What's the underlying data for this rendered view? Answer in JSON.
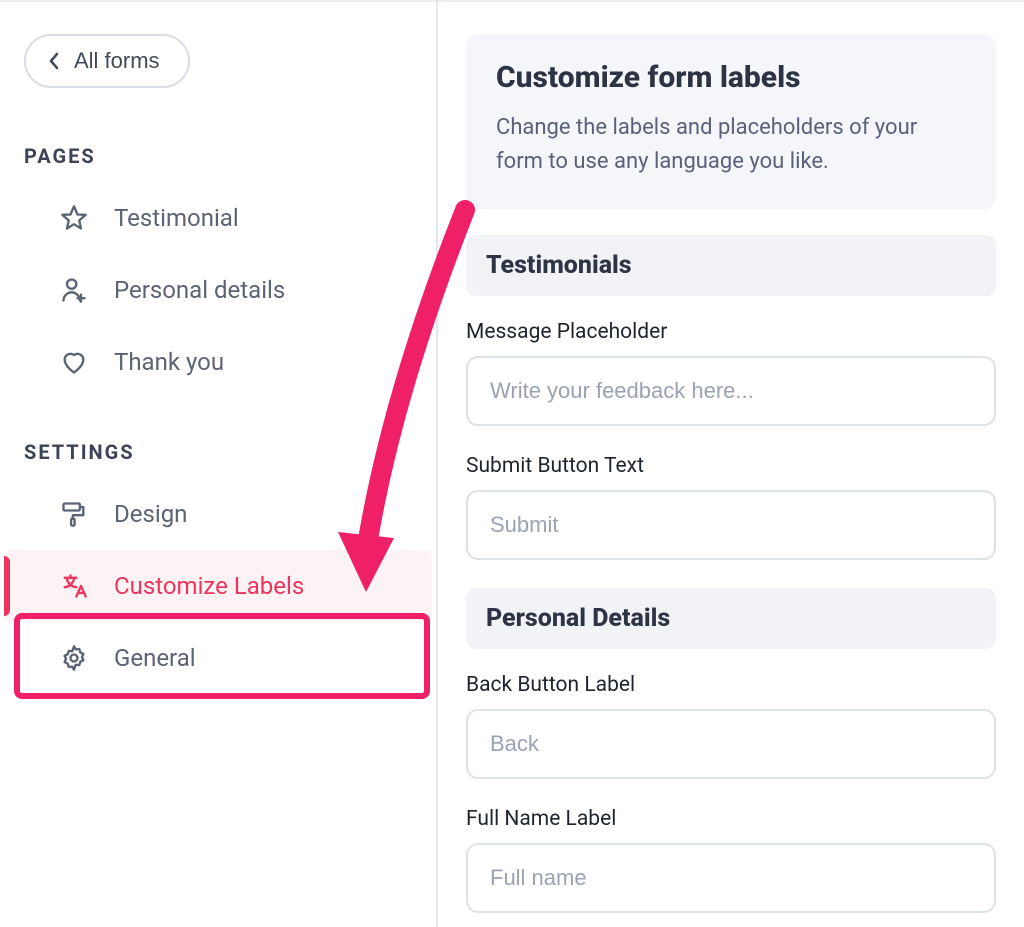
{
  "back_button_label": "All forms",
  "sidebar": {
    "section_pages": "PAGES",
    "section_settings": "SETTINGS",
    "pages": [
      {
        "label": "Testimonial"
      },
      {
        "label": "Personal details"
      },
      {
        "label": "Thank you"
      }
    ],
    "settings": [
      {
        "label": "Design"
      },
      {
        "label": "Customize Labels"
      },
      {
        "label": "General"
      }
    ]
  },
  "main": {
    "header_title": "Customize form labels",
    "header_sub": "Change the labels and placeholders of your form to use any language you like.",
    "sections": {
      "testimonials": {
        "title": "Testimonials",
        "message_placeholder_label": "Message Placeholder",
        "message_placeholder_value": "Write your feedback here...",
        "submit_button_label": "Submit Button Text",
        "submit_button_value": "Submit"
      },
      "personal_details": {
        "title": "Personal Details",
        "back_button_label": "Back Button Label",
        "back_button_value": "Back",
        "fullname_label": "Full Name Label",
        "fullname_value": "Full name"
      }
    }
  },
  "colors": {
    "accent": "#eb355f"
  }
}
